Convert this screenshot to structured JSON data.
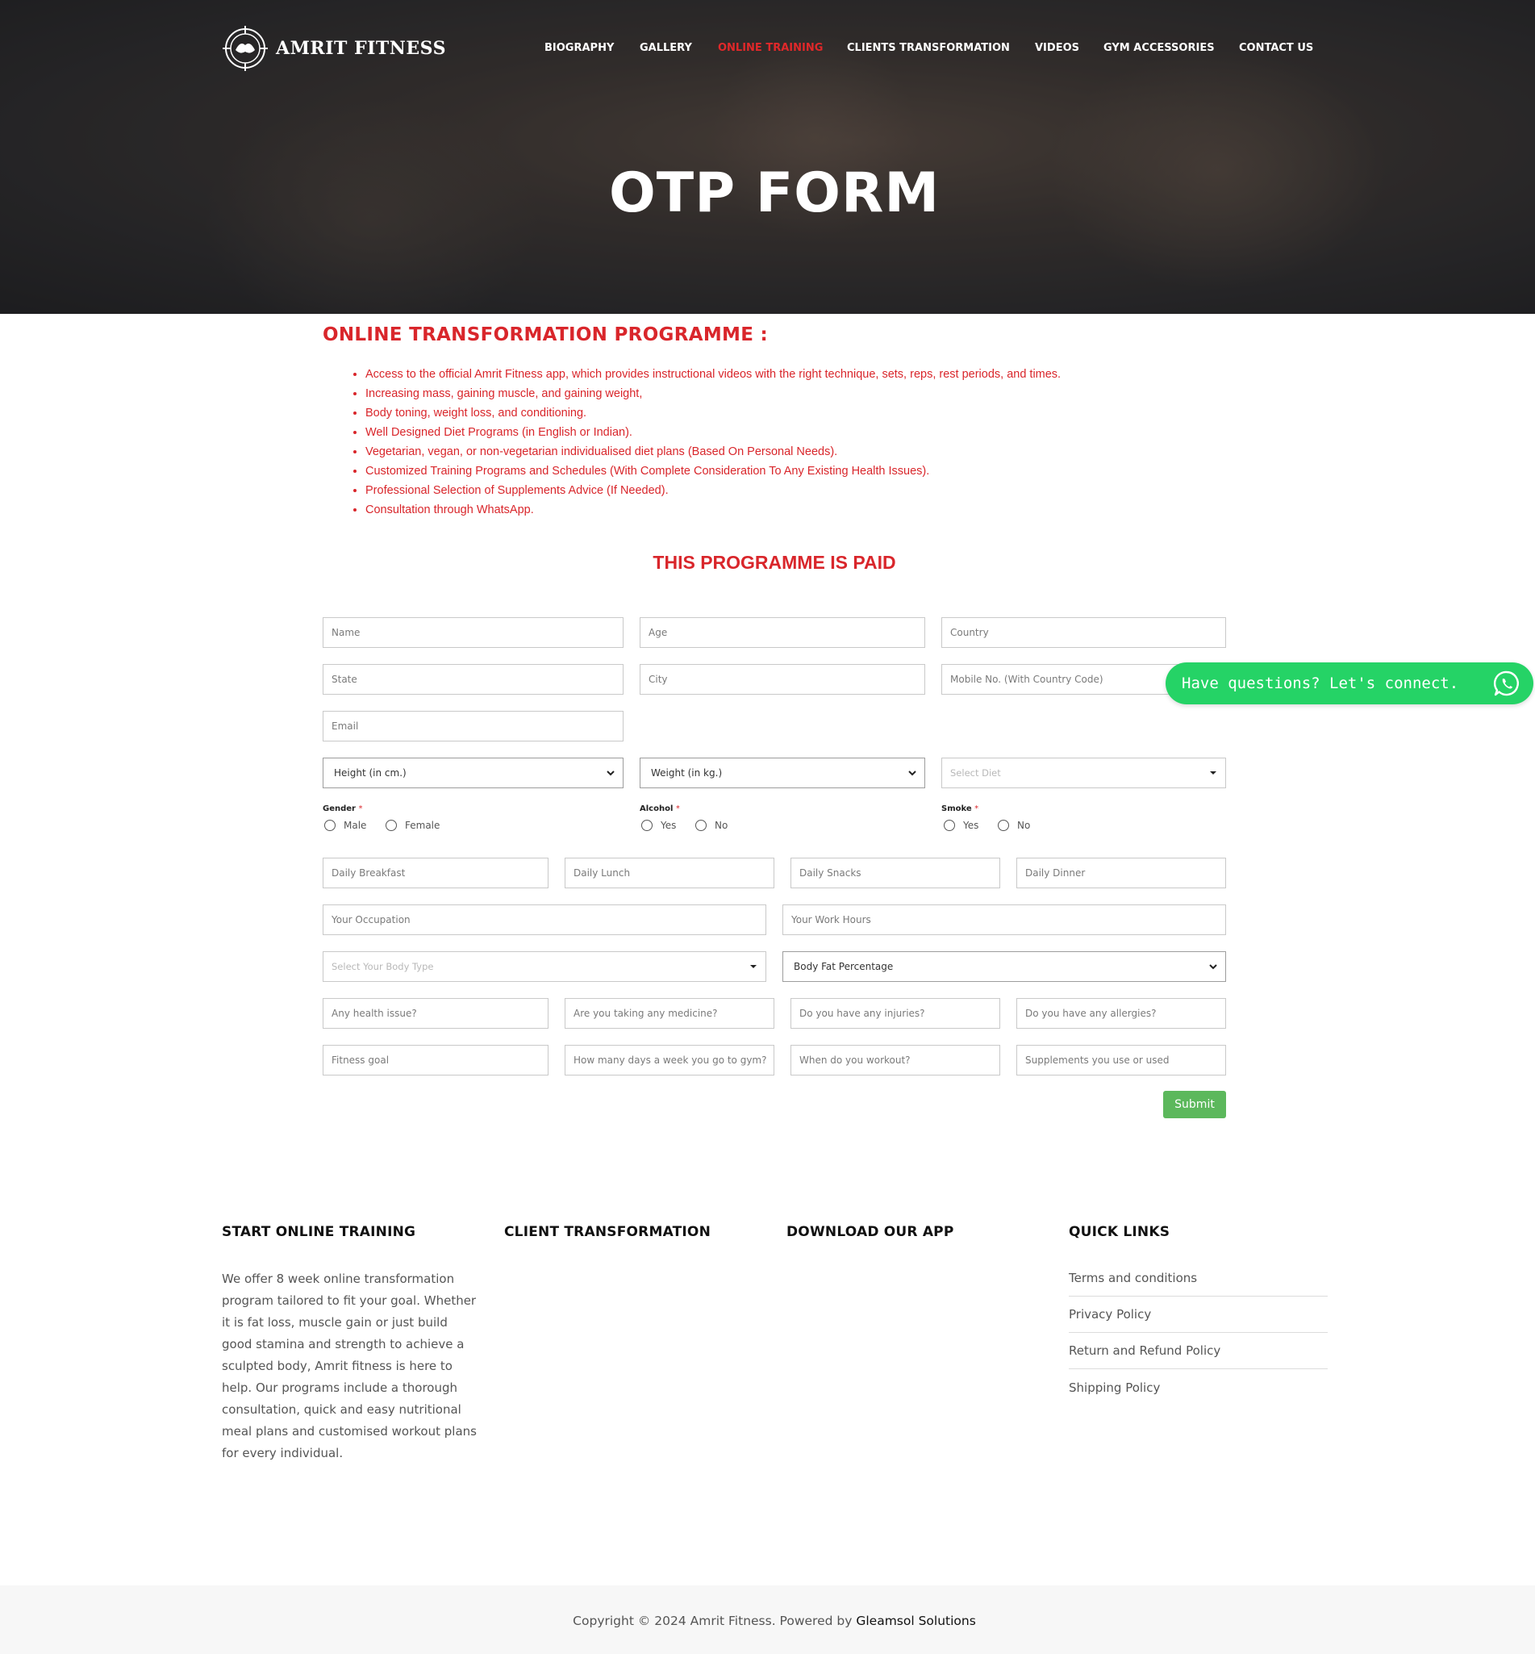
{
  "brand": {
    "name": "AMRIT FITNESS"
  },
  "nav": {
    "items": [
      {
        "label": "BIOGRAPHY"
      },
      {
        "label": "GALLERY"
      },
      {
        "label": "ONLINE TRAINING"
      },
      {
        "label": "CLIENTS TRANSFORMATION"
      },
      {
        "label": "VIDEOS"
      },
      {
        "label": "GYM ACCESSORIES"
      },
      {
        "label": "CONTACT US"
      }
    ],
    "active": "ONLINE TRAINING",
    "active_color": "#e0282a"
  },
  "hero": {
    "title": "OTP FORM"
  },
  "programme": {
    "title": "ONLINE TRANSFORMATION PROGRAMME :",
    "features": [
      "Access to the official Amrit Fitness app, which provides instructional videos with the right technique, sets, reps, rest periods, and times.",
      "Increasing mass, gaining muscle, and gaining weight,",
      "Body toning, weight loss, and conditioning.",
      "Well Designed Diet Programs (in English or Indian).",
      "Vegetarian, vegan, or non-vegetarian individualised diet plans (Based On Personal Needs).",
      "Customized Training Programs and Schedules (With Complete Consideration To Any Existing Health Issues).",
      "Professional Selection of Supplements Advice (If Needed).",
      "Consultation through WhatsApp."
    ],
    "paid_notice": "THIS PROGRAMME IS PAID",
    "accent_color": "#d9262b"
  },
  "form": {
    "name": "Name",
    "age": "Age",
    "country": "Country",
    "state": "State",
    "city": "City",
    "mobile": "Mobile No. (With Country Code)",
    "email": "Email",
    "height": "Height (in cm.)",
    "weight": "Weight (in kg.)",
    "diet": "Select Diet",
    "gender": {
      "label": "Gender",
      "required": "*",
      "options": [
        "Male",
        "Female"
      ]
    },
    "alcohol": {
      "label": "Alcohol",
      "required": "*",
      "options": [
        "Yes",
        "No"
      ]
    },
    "smoke": {
      "label": "Smoke",
      "required": "*",
      "options": [
        "Yes",
        "No"
      ]
    },
    "breakfast": "Daily Breakfast",
    "lunch": "Daily Lunch",
    "snacks": "Daily Snacks",
    "dinner": "Daily Dinner",
    "occupation": "Your Occupation",
    "work_hours": "Your Work Hours",
    "body_type": "Select Your Body Type",
    "body_fat": "Body Fat Percentage",
    "health_issue": "Any health issue?",
    "medicine": "Are you taking any medicine?",
    "injuries": "Do you have any injuries?",
    "allergies": "Do you have any allergies?",
    "fitness_goal": "Fitness goal",
    "gym_days": "How many days a week you go to gym?",
    "workout_time": "When do you workout?",
    "supplements": "Supplements you use or used",
    "submit": "Submit",
    "submit_color": "#5cb85c"
  },
  "whatsapp": {
    "label": "Have questions? Let's connect.",
    "color": "#25d366",
    "icon": "whatsapp-icon"
  },
  "footer": {
    "col1": {
      "title": "START ONLINE TRAINING",
      "text": "We offer 8 week online transformation program tailored to fit your goal. Whether it is fat loss, muscle gain or just build good stamina and strength to achieve a sculpted body, Amrit fitness is here to help. Our programs include a thorough consultation, quick and easy nutritional meal plans and customised workout plans for every individual."
    },
    "col2": {
      "title": "CLIENT TRANSFORMATION"
    },
    "col3": {
      "title": "DOWNLOAD OUR APP"
    },
    "col4": {
      "title": "QUICK LINKS",
      "links": [
        "Terms and conditions",
        "Privacy Policy",
        "Return and Refund Policy",
        "Shipping Policy"
      ]
    },
    "copyright": "Copyright © 2024 Amrit Fitness. Powered by",
    "powered_by": "Gleamsol Solutions"
  }
}
